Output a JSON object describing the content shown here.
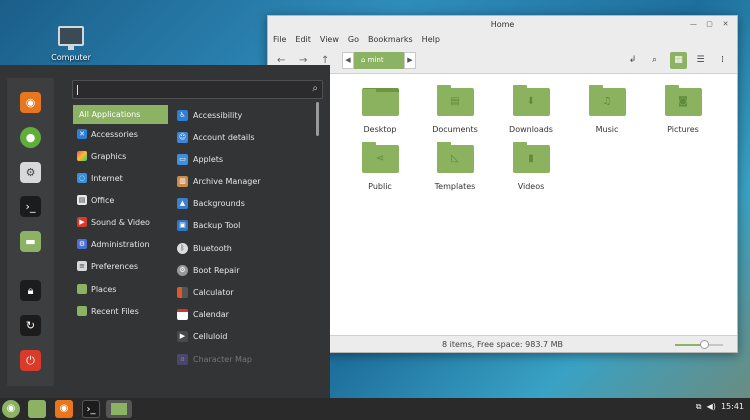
{
  "desktop": {
    "computer_label": "Computer"
  },
  "file_manager": {
    "title": "Home",
    "menu": [
      "File",
      "Edit",
      "View",
      "Go",
      "Bookmarks",
      "Help"
    ],
    "location": "mint",
    "folders": [
      "Desktop",
      "Documents",
      "Downloads",
      "Music",
      "Pictures",
      "Public",
      "Templates",
      "Videos"
    ],
    "status": "8 items, Free space: 983.7 MB",
    "zoom_level": 0.6
  },
  "menu": {
    "search_placeholder": "",
    "categories": [
      "All Applications",
      "Accessories",
      "Graphics",
      "Internet",
      "Office",
      "Sound & Video",
      "Administration",
      "Preferences",
      "Places",
      "Recent Files"
    ],
    "apps": [
      "Accessibility",
      "Account details",
      "Applets",
      "Archive Manager",
      "Backgrounds",
      "Backup Tool",
      "Bluetooth",
      "Boot Repair",
      "Calculator",
      "Calendar",
      "Celluloid",
      "Character Map"
    ]
  },
  "panel": {
    "clock": "15:41"
  },
  "colors": {
    "accent": "#8cb363",
    "menu_bg": "#333436",
    "panel_bg": "#2a2a2b"
  }
}
